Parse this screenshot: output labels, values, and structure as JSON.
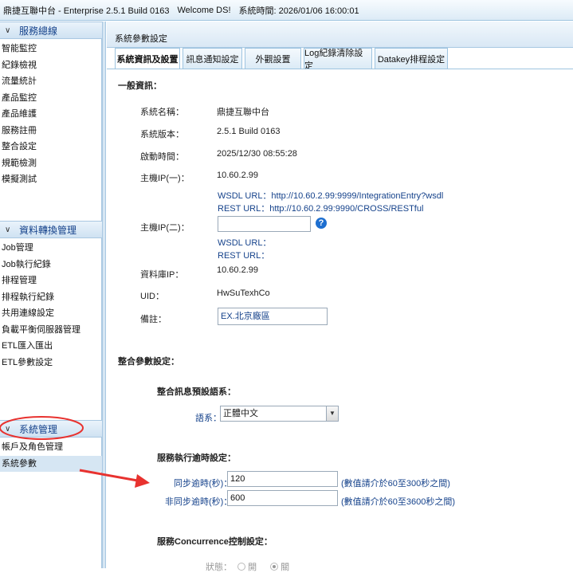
{
  "topbar": {
    "app_title": "鼎捷互聯中台 - Enterprise 2.5.1 Build 0163",
    "welcome": "Welcome DS!",
    "system_time": "系統時間: 2026/01/06 16:00:01"
  },
  "sidebar": {
    "sections": [
      {
        "title": "服務總線",
        "items": [
          "智能監控",
          "紀錄檢視",
          "流量統計",
          "產品監控",
          "產品維護",
          "服務註冊",
          "整合設定",
          "規範檢測",
          "模擬測試"
        ]
      },
      {
        "title": "資料轉換管理",
        "items": [
          "Job管理",
          "Job執行紀錄",
          "排程管理",
          "排程執行紀錄",
          "共用連線設定",
          "負載平衡伺服器管理",
          "ETL匯入匯出",
          "ETL參數設定"
        ]
      },
      {
        "title": "系統管理",
        "items": [
          "帳戶及角色管理",
          "系統參數"
        ]
      }
    ]
  },
  "main": {
    "title": "系統參數設定",
    "tabs": [
      "系統資訊及設置",
      "訊息通知設定",
      "外觀設置",
      "Log紀錄清除設定",
      "Datakey排程設定"
    ],
    "general": {
      "heading": "一般資訊：",
      "system_name_label": "系統名稱：",
      "system_name": "鼎捷互聯中台",
      "version_label": "系統版本：",
      "version": "2.5.1 Build 0163",
      "start_label": "啟動時間：",
      "start_time": "2025/12/30 08:55:28",
      "host1_label": "主機IP(一)：",
      "host1": "10.60.2.99",
      "wsdl1": "WSDL URL：http://10.60.2.99:9999/IntegrationEntry?wsdl",
      "rest1": "REST URL：http://10.60.2.99:9990/CROSS/RESTful",
      "host2_label": "主機IP(二)：",
      "host2_value": "",
      "wsdl2": "WSDL URL：",
      "rest2": "REST URL：",
      "db_label": "資料庫IP：",
      "db_ip": "10.60.2.99",
      "uid_label": "UID：",
      "uid": "HwSuTexhCo",
      "note_label": "備註：",
      "note": "EX.北京廠區"
    },
    "integration": {
      "heading": "整合參數設定：",
      "lang_heading": "整合訊息預設語系：",
      "lang_label": "語系：",
      "lang_value": "正體中文",
      "timeout_heading": "服務執行逾時設定：",
      "sync_label": "同步逾時(秒)：",
      "sync_value": "120",
      "sync_hint": "(數值請介於60至300秒之間)",
      "async_label": "非同步逾時(秒)：",
      "async_value": "600",
      "async_hint": "(數值請介於60至3600秒之間)",
      "conc_heading": "服務Concurrence控制設定：",
      "status_label": "狀態：",
      "opt_on": "開",
      "opt_off": "關"
    }
  },
  "colors": {
    "accent": "#15428b",
    "highlight_red": "#e8322f"
  }
}
